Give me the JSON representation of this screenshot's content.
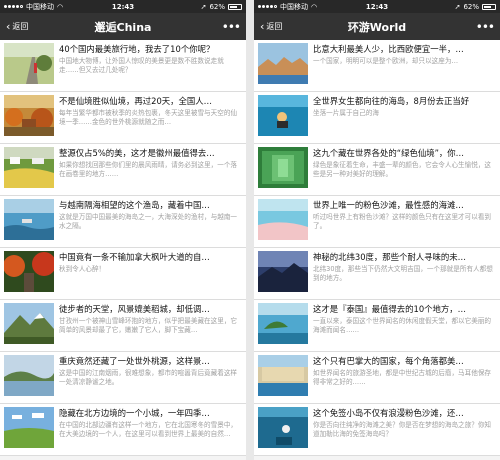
{
  "screens": [
    {
      "status": {
        "carrier": "中国移动",
        "time": "12:43",
        "battery": "62%"
      },
      "nav": {
        "back": "返回",
        "title": "邂逅China"
      },
      "items": [
        {
          "title": "40个国内最美旅行地，我去了10个你呢？",
          "subtitle": "中国地大物博，让外国人惊叹的美景更是数不胜数说走就走……但又去过几处呢？",
          "thumb": "road"
        },
        {
          "title": "不是仙境胜似仙境，再过20天，全国人…",
          "subtitle": "每年当繁华都市被秋季的炎热包裹，冬天这里被雪与天空的仙境一季……金色的世外桃源就随之而…",
          "thumb": "autumn"
        },
        {
          "title": "整源仅占5%的美，这才是徽州最值得去…",
          "subtitle": "如果你想找回那些你们里的晨风雨晴，请务必到这里，一个落在画卷里的地方……",
          "thumb": "field"
        },
        {
          "title": "与越南隔海相望的这个渔岛，藏着中国…",
          "subtitle": "这就是万国中国最美的海岛之一，大海深处的渔村，与越南一水之隔。",
          "thumb": "sea"
        },
        {
          "title": "中国竟有一条不输加拿大枫叶大道的自…",
          "subtitle": "秋到令人心醉！",
          "thumb": "maple"
        },
        {
          "title": "徒步者的天堂，风景媲美稻城，却低调…",
          "subtitle": "甘孜州一个被神山雪峰环抱的地方，似乎把最美藏在这里，它简单的风景却最了它，嫩嫩了它人，脚下宝藏…",
          "thumb": "mountain"
        },
        {
          "title": "重庆竟然还藏了一处世外桃源，这样景…",
          "subtitle": "这是中国的江南烟雨，很难想象，都市的喧嚣背后竟藏着这样一处清凉静谧之地。",
          "thumb": "lake"
        },
        {
          "title": "隐藏在北方边境的一个小城，一年四季…",
          "subtitle": "在中国的北部边疆有这样一个地方，它在北国寒冬的雪景中，在大美边境的一个人，在这里可以看到世界上最美的自然…",
          "thumb": "grass"
        }
      ]
    },
    {
      "status": {
        "carrier": "中国移动",
        "time": "12:43",
        "battery": "62%"
      },
      "nav": {
        "back": "返回",
        "title": "环游World"
      },
      "items": [
        {
          "title": "比意大利最美人少，比西欧便宜一半，…",
          "subtitle": "一个国家，明明可以是整个欧洲，却只以这座为…",
          "thumb": "town"
        },
        {
          "title": "全世界女生都向往的海岛，8月份去正当好",
          "subtitle": "坐落一片属于自己的海",
          "thumb": "diver"
        },
        {
          "title": "这九个藏在世界各处的“绿色仙境”，你…",
          "subtitle": "绿色是象征着生命，丰盛一辈的颜色，它会令人心生愉悦，这些是另一种对美好的理解。",
          "thumb": "green"
        },
        {
          "title": "世界上唯一的粉色沙滩，最性感的海滩…",
          "subtitle": "听过吗世界上有粉色沙滩？这样的颜色只有在这里才可以看到了。",
          "thumb": "beach"
        },
        {
          "title": "神秘的北纬30度，那些个耐人寻味的未…",
          "subtitle": "北纬30度，那些当下仍然大文明吉国，一个那就是所有人都想到的地方。",
          "thumb": "dusk"
        },
        {
          "title": "这才是『泰国』最值得去的10个地方，…",
          "subtitle": "一直以来，泰国这个世界闻名的休闲度假天堂，都以它美丽的海滩而闻名……",
          "thumb": "island"
        },
        {
          "title": "这个只有巴掌大的国家，每个角落都美…",
          "subtitle": "如世界闻名的旅游圣地，都是中世纪古城的后裔，马耳他保存得非常之好的……",
          "thumb": "harbor"
        },
        {
          "title": "这个免签小岛不仅有浪漫粉色沙滩，还…",
          "subtitle": "你是否向往纯净的海滩之美？你是否在梦想的海岛之旅？你知道加勒比海的免签海岛吗？",
          "thumb": "underwater"
        }
      ]
    }
  ]
}
